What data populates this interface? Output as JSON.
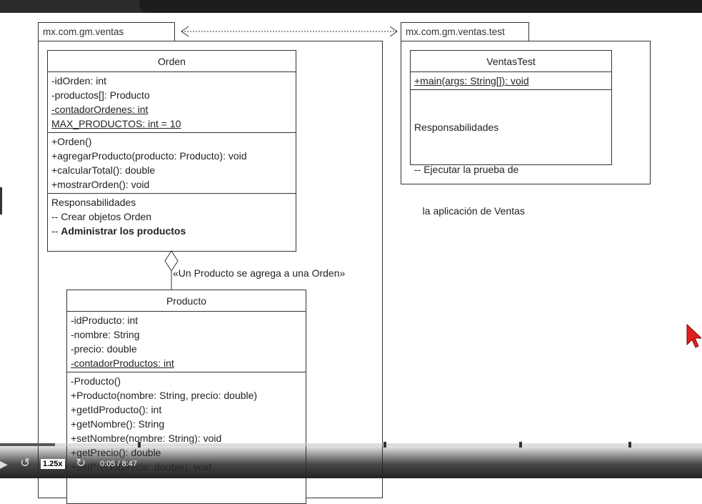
{
  "packages": {
    "main": "mx.com.gm.ventas",
    "test": "mx.com.gm.ventas.test"
  },
  "orden": {
    "name": "Orden",
    "attributes": [
      {
        "t": "-idOrden: int",
        "u": false
      },
      {
        "t": "-productos[]: Producto",
        "u": false
      },
      {
        "t": "-contadorOrdenes: int",
        "u": true
      },
      {
        "t": "MAX_PRODUCTOS: int = 10",
        "u": true
      }
    ],
    "methods": [
      "+Orden()",
      "+agregarProducto(producto: Producto): void",
      "+calcularTotal(): double",
      "+mostrarOrden(): void"
    ],
    "resp_title": "Responsabilidades",
    "resp": [
      "-- Crear objetos Orden"
    ],
    "resp_bold": "Administrar los productos",
    "resp_bold_prefix": "-- "
  },
  "ventasTest": {
    "name": "VentasTest",
    "method": "+main(args: String[]): void",
    "resp_title": "Responsabilidades",
    "resp": [
      "-- Ejecutar la prueba de",
      "   la aplicación de Ventas"
    ]
  },
  "aggregation_label": "«Un Producto se agrega a una Orden»",
  "producto": {
    "name": "Producto",
    "attributes": [
      {
        "t": "-idProducto: int",
        "u": false
      },
      {
        "t": "-nombre: String",
        "u": false
      },
      {
        "t": "-precio: double",
        "u": false
      },
      {
        "t": "-contadorProductos: int",
        "u": true
      }
    ],
    "methods": [
      "-Producto()",
      "+Producto(nombre: String, precio: double)",
      "+getIdProducto(): int",
      "+getNombre(): String",
      "+setNombre(nombre: String): void",
      "+getPrecio(): double",
      "+setPrecio(precio: double): void"
    ]
  },
  "player": {
    "speed": "1.25x",
    "time": "0:05 / 8:47",
    "progress_percent": 1,
    "icons": [
      "play-icon",
      "replay-icon",
      "forward-icon"
    ]
  },
  "colors": {
    "cursor": "#e02020"
  }
}
